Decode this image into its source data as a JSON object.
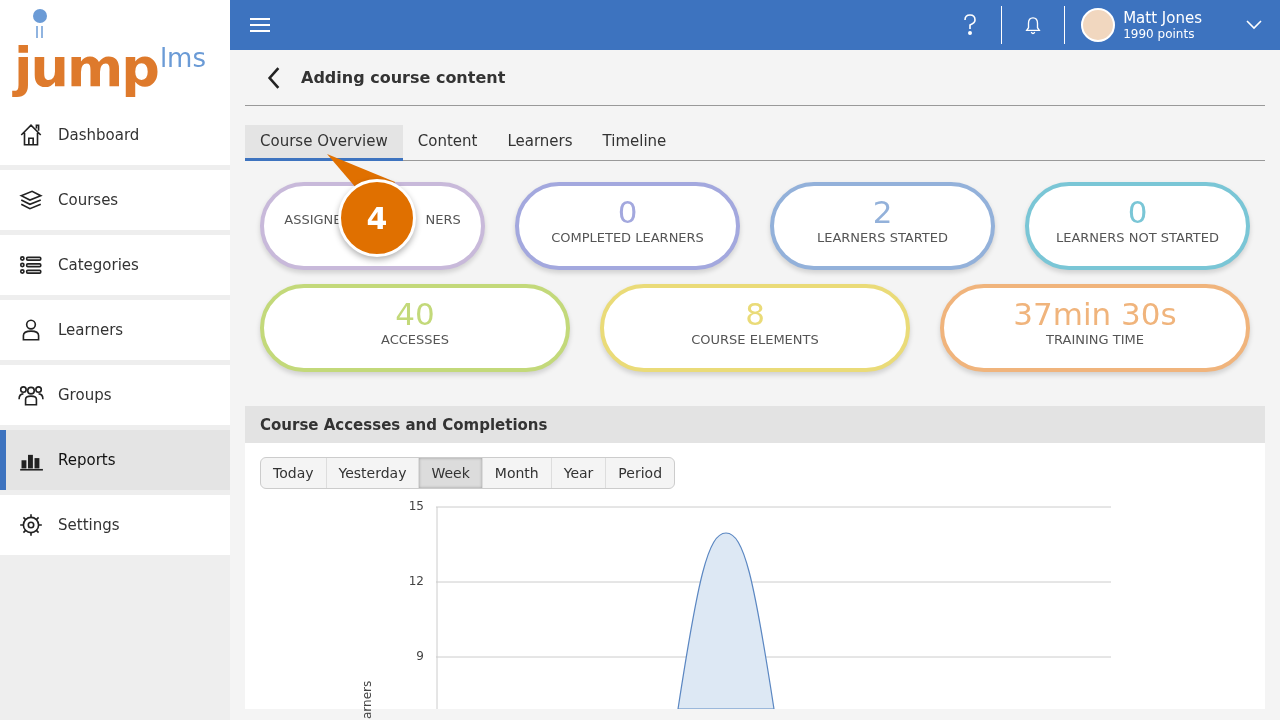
{
  "logo": {
    "main": "jump",
    "suffix": "lms"
  },
  "sidebar": {
    "items": [
      {
        "label": "Dashboard",
        "selected": false
      },
      {
        "label": "Courses",
        "selected": false
      },
      {
        "label": "Categories",
        "selected": false
      },
      {
        "label": "Learners",
        "selected": false
      },
      {
        "label": "Groups",
        "selected": false
      },
      {
        "label": "Reports",
        "selected": true
      },
      {
        "label": "Settings",
        "selected": false
      }
    ]
  },
  "topbar": {
    "user": {
      "name": "Matt Jones",
      "points": "1990 points"
    }
  },
  "page": {
    "title": "Adding course content"
  },
  "tabs": [
    {
      "label": "Course Overview",
      "selected": true
    },
    {
      "label": "Content",
      "selected": false
    },
    {
      "label": "Learners",
      "selected": false
    },
    {
      "label": "Timeline",
      "selected": false
    }
  ],
  "stats_row_1": [
    {
      "label_parts": [
        "ASSIGNE",
        "NERS"
      ],
      "color": "#c8b9da"
    },
    {
      "value": "0",
      "label_parts": [
        "COMPLETED LEARNERS"
      ],
      "color": "#a3a8de"
    },
    {
      "value": "2",
      "label_parts": [
        "LEARNERS STARTED"
      ],
      "color": "#93b1da"
    },
    {
      "value": "0",
      "label_parts": [
        "LEARNERS NOT STARTED"
      ],
      "color": "#7ac6d6"
    }
  ],
  "stats_row_2": [
    {
      "value": "40",
      "label_parts": [
        "ACCESSES"
      ],
      "color": "#c3d97a"
    },
    {
      "value": "8",
      "label_parts": [
        "COURSE ELEMENTS"
      ],
      "color": "#eadb78"
    },
    {
      "value": "37min 30s",
      "label_parts": [
        "TRAINING TIME"
      ],
      "color": "#f0b47c"
    }
  ],
  "callout": {
    "number": "4"
  },
  "report": {
    "title": "Course Accesses and Completions",
    "periods": [
      {
        "label": "Today",
        "selected": false
      },
      {
        "label": "Yesterday",
        "selected": false
      },
      {
        "label": "Week",
        "selected": true
      },
      {
        "label": "Month",
        "selected": false
      },
      {
        "label": "Year",
        "selected": false
      },
      {
        "label": "Period",
        "selected": false
      }
    ],
    "y_ticks": [
      "15",
      "12",
      "9"
    ],
    "y_axis_label": "arners"
  }
}
